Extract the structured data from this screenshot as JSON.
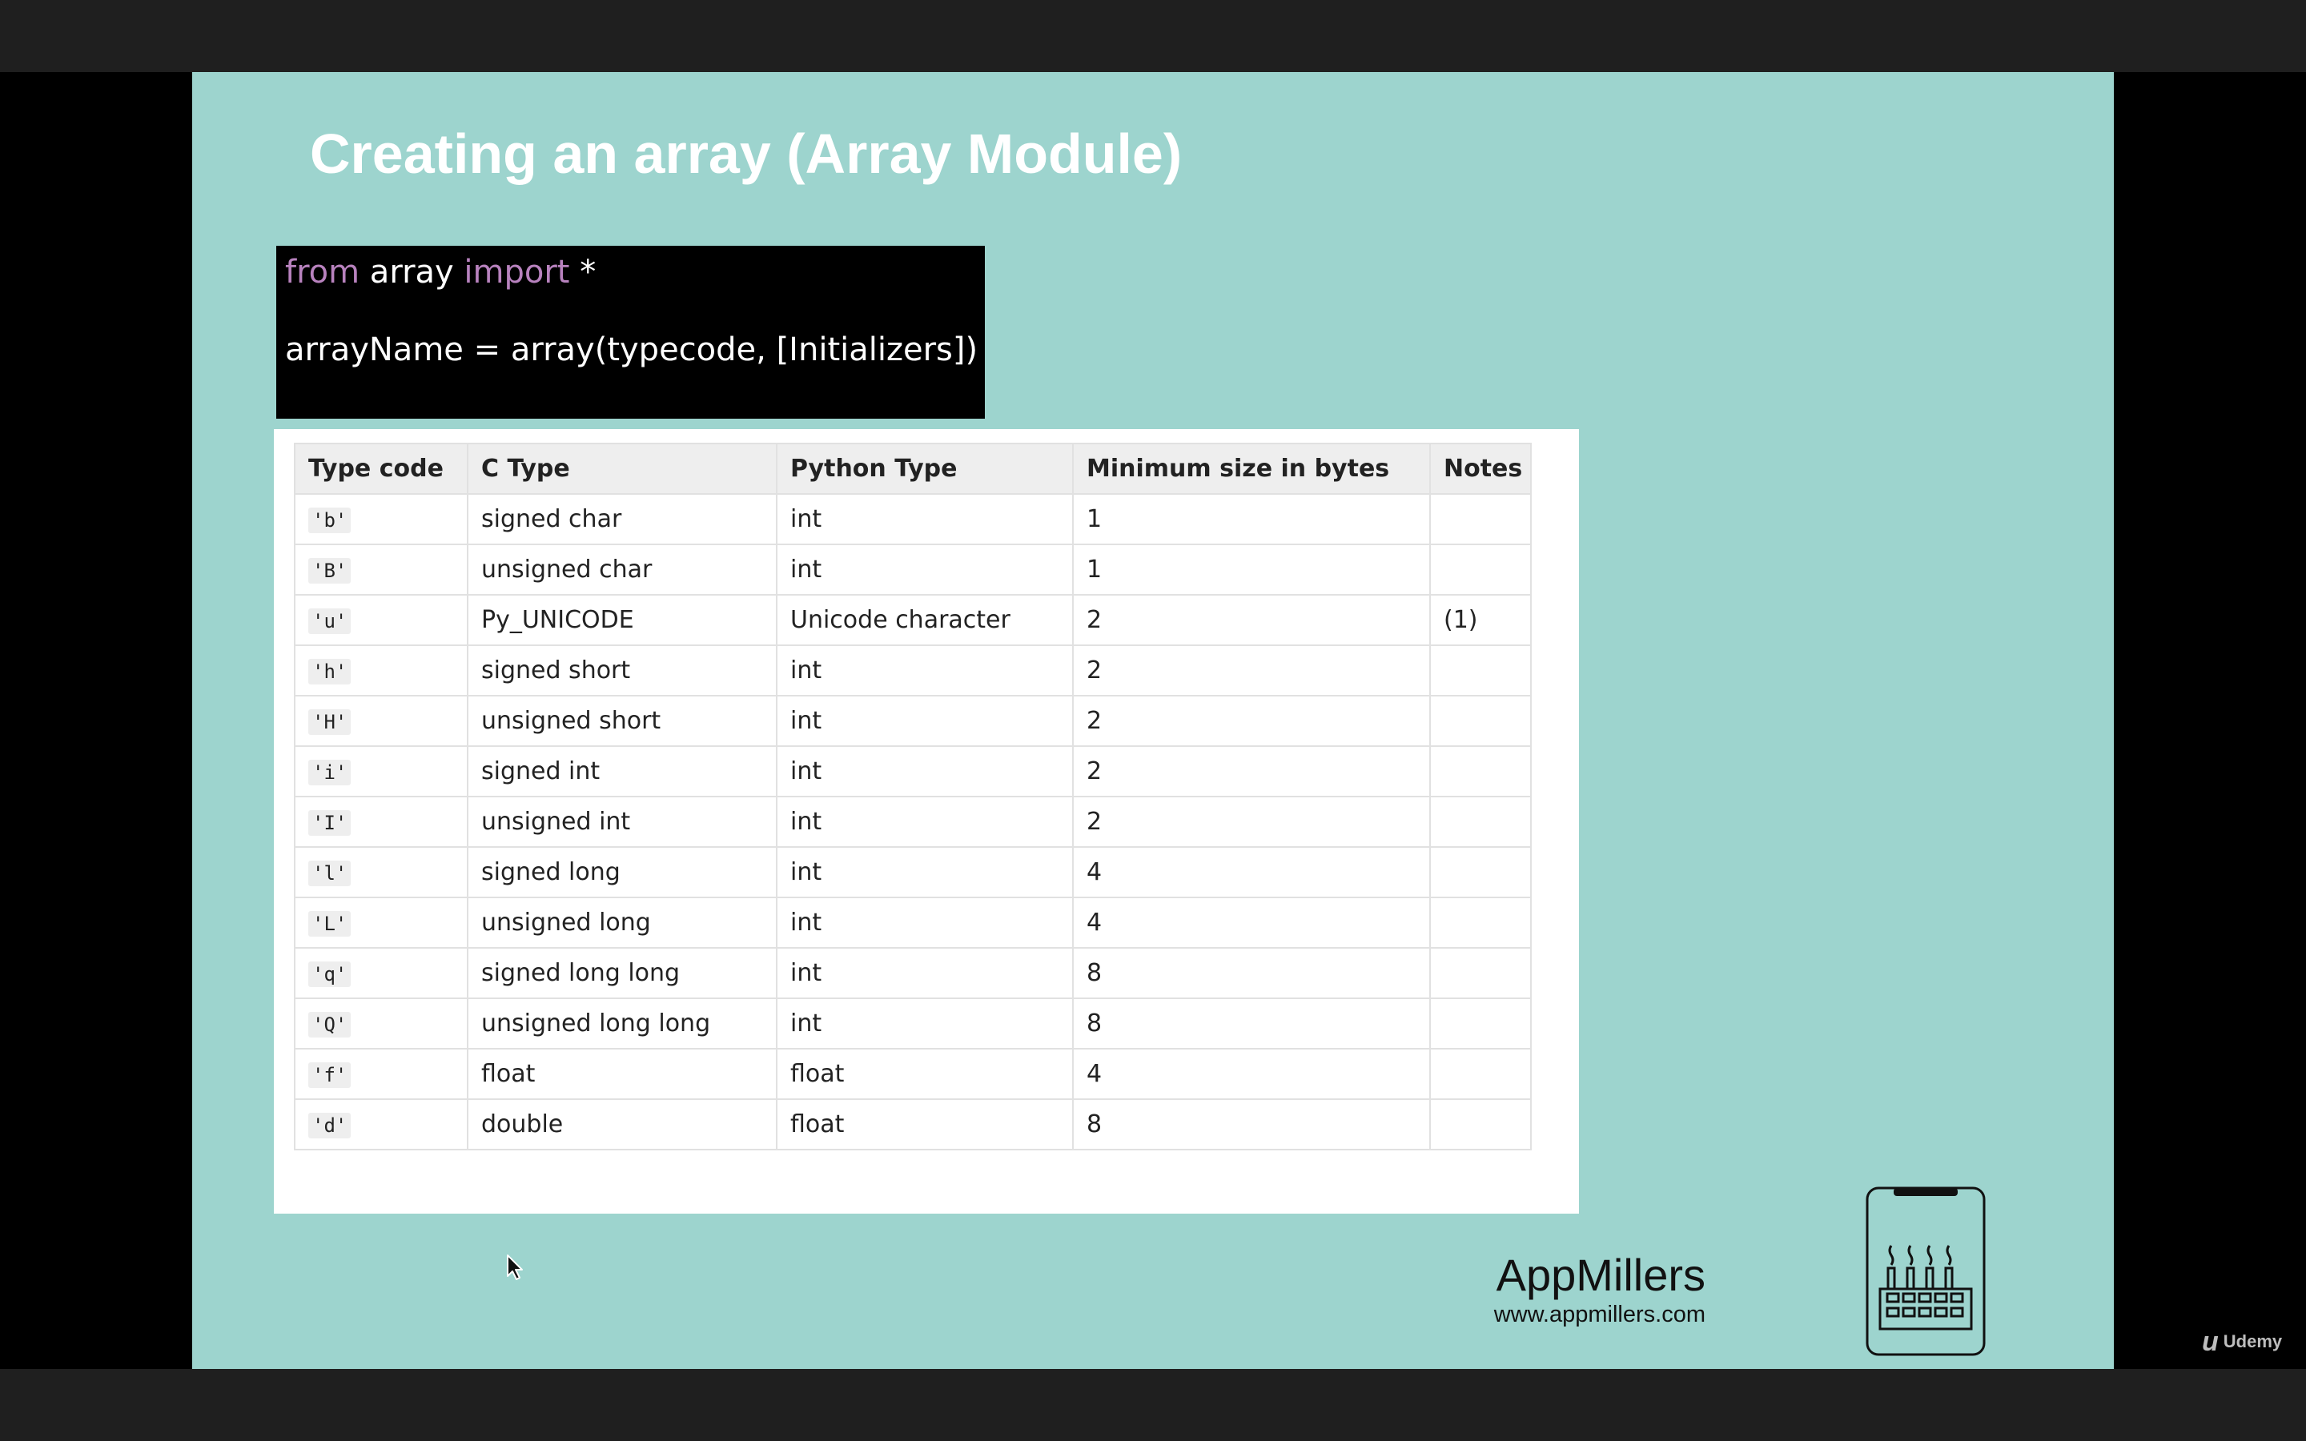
{
  "slide": {
    "title": "Creating an array (Array Module)"
  },
  "code": {
    "line1": {
      "kw_from": "from",
      "module": " array ",
      "kw_import": "import",
      "star": " *"
    },
    "line2": "arrayName = array(typecode, [Initializers])"
  },
  "table": {
    "headers": [
      "Type code",
      "C Type",
      "Python Type",
      "Minimum size in bytes",
      "Notes"
    ],
    "rows": [
      {
        "code": "'b'",
        "ctype": "signed char",
        "pytype": "int",
        "size": "1",
        "notes": ""
      },
      {
        "code": "'B'",
        "ctype": "unsigned char",
        "pytype": "int",
        "size": "1",
        "notes": ""
      },
      {
        "code": "'u'",
        "ctype": "Py_UNICODE",
        "pytype": "Unicode character",
        "size": "2",
        "notes": "(1)"
      },
      {
        "code": "'h'",
        "ctype": "signed short",
        "pytype": "int",
        "size": "2",
        "notes": ""
      },
      {
        "code": "'H'",
        "ctype": "unsigned short",
        "pytype": "int",
        "size": "2",
        "notes": ""
      },
      {
        "code": "'i'",
        "ctype": "signed int",
        "pytype": "int",
        "size": "2",
        "notes": ""
      },
      {
        "code": "'I'",
        "ctype": "unsigned int",
        "pytype": "int",
        "size": "2",
        "notes": ""
      },
      {
        "code": "'l'",
        "ctype": "signed long",
        "pytype": "int",
        "size": "4",
        "notes": ""
      },
      {
        "code": "'L'",
        "ctype": "unsigned long",
        "pytype": "int",
        "size": "4",
        "notes": ""
      },
      {
        "code": "'q'",
        "ctype": "signed long long",
        "pytype": "int",
        "size": "8",
        "notes": ""
      },
      {
        "code": "'Q'",
        "ctype": "unsigned long long",
        "pytype": "int",
        "size": "8",
        "notes": ""
      },
      {
        "code": "'f'",
        "ctype": "float",
        "pytype": "float",
        "size": "4",
        "notes": ""
      },
      {
        "code": "'d'",
        "ctype": "double",
        "pytype": "float",
        "size": "8",
        "notes": ""
      }
    ]
  },
  "brand": {
    "name": "AppMillers",
    "url": "www.appmillers.com",
    "logo_icon": "phone-factory-icon"
  },
  "watermark": {
    "glyph": "u",
    "label": "Udemy"
  },
  "colors": {
    "slide_background": "#9dd4ce",
    "keyword": "#b882be",
    "code_background": "#000000"
  }
}
